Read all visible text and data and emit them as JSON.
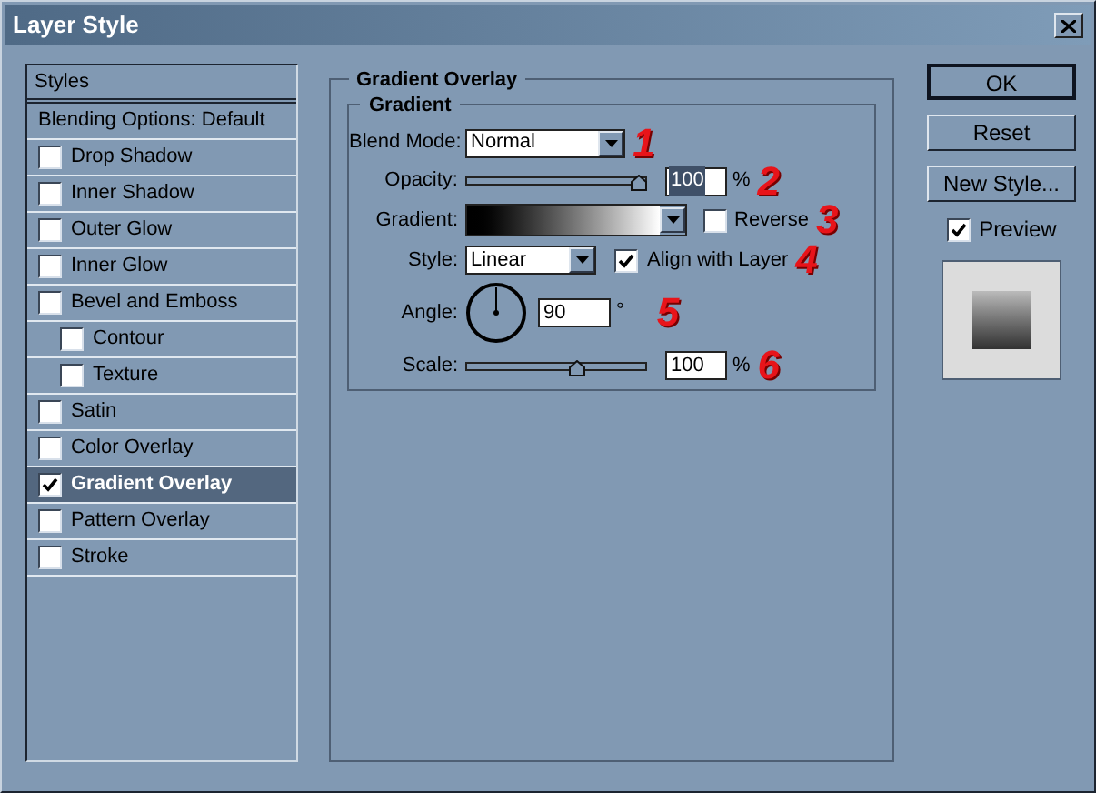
{
  "window": {
    "title": "Layer Style"
  },
  "styles_panel": {
    "header": "Styles",
    "items": [
      {
        "label": "Blending Options: Default",
        "kind": "plain",
        "selected": false
      },
      {
        "label": "Drop Shadow",
        "kind": "checkbox",
        "checked": false,
        "selected": false
      },
      {
        "label": "Inner Shadow",
        "kind": "checkbox",
        "checked": false,
        "selected": false
      },
      {
        "label": "Outer Glow",
        "kind": "checkbox",
        "checked": false,
        "selected": false
      },
      {
        "label": "Inner Glow",
        "kind": "checkbox",
        "checked": false,
        "selected": false
      },
      {
        "label": "Bevel and Emboss",
        "kind": "checkbox",
        "checked": false,
        "selected": false,
        "children": [
          {
            "label": "Contour",
            "kind": "checkbox",
            "checked": false,
            "selected": false
          },
          {
            "label": "Texture",
            "kind": "checkbox",
            "checked": false,
            "selected": false
          }
        ]
      },
      {
        "label": "Satin",
        "kind": "checkbox",
        "checked": false,
        "selected": false
      },
      {
        "label": "Color Overlay",
        "kind": "checkbox",
        "checked": false,
        "selected": false
      },
      {
        "label": "Gradient Overlay",
        "kind": "checkbox",
        "checked": true,
        "selected": true
      },
      {
        "label": "Pattern Overlay",
        "kind": "checkbox",
        "checked": false,
        "selected": false
      },
      {
        "label": "Stroke",
        "kind": "checkbox",
        "checked": false,
        "selected": false
      }
    ]
  },
  "settings": {
    "title": "Gradient Overlay",
    "group": "Gradient",
    "blend_mode": {
      "label": "Blend Mode:",
      "value": "Normal",
      "marker": "1"
    },
    "opacity": {
      "label": "Opacity:",
      "level": 1,
      "value": "100",
      "text_selected": true,
      "unit": "%",
      "marker": "2"
    },
    "gradient": {
      "label": "Gradient:"
    },
    "reverse": {
      "label": "Reverse",
      "checked": false,
      "marker": "3"
    },
    "style": {
      "label": "Style:",
      "value": "Linear"
    },
    "align": {
      "label": "Align with Layer",
      "checked": true,
      "marker": "4"
    },
    "angle": {
      "label": "Angle:",
      "value": "90",
      "unit": "°",
      "marker": "5"
    },
    "scale": {
      "label": "Scale:",
      "level": 0.62,
      "value": "100",
      "text_selected": false,
      "unit": "%",
      "marker": "6"
    }
  },
  "buttons": [
    {
      "label": "OK",
      "default": true
    },
    {
      "label": "Reset",
      "default": false
    },
    {
      "label": "New Style...",
      "default": false
    }
  ],
  "preview": {
    "label": "Preview",
    "checked": true
  }
}
